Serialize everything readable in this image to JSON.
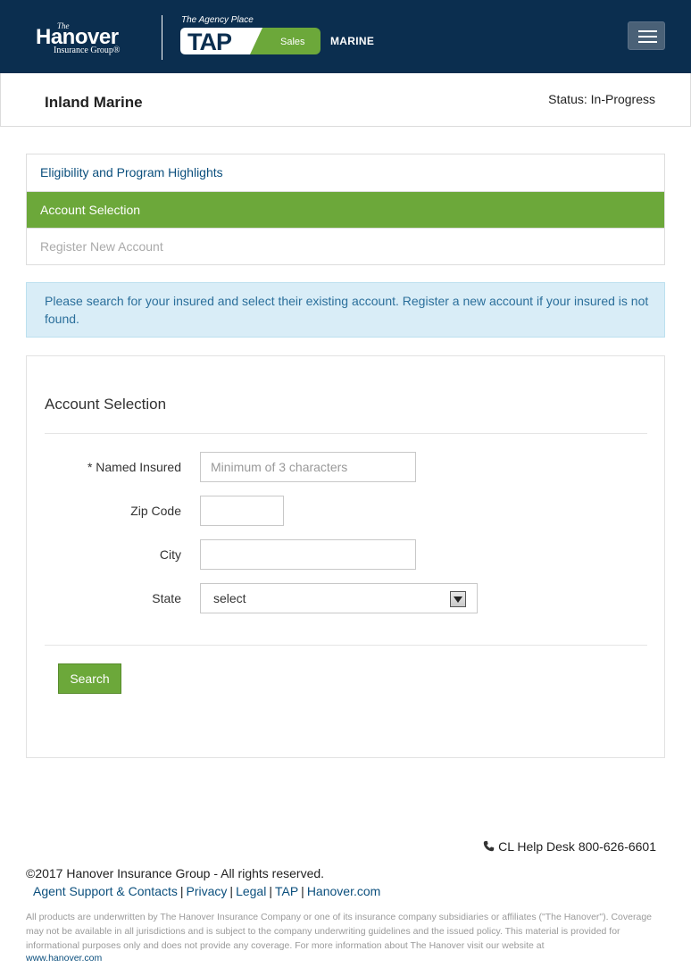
{
  "header": {
    "brand": {
      "the": "The",
      "name": "Hanover",
      "sub": "Insurance Group®"
    },
    "tap": {
      "caption": "The Agency Place",
      "badge_text": "TAP",
      "badge_sub": "Sales",
      "product": "MARINE"
    },
    "colors": {
      "navy": "#0b2e4f",
      "green": "#6ca83a"
    }
  },
  "title_bar": {
    "title": "Inland Marine",
    "status": "Status: In-Progress"
  },
  "steps": [
    {
      "label": "Eligibility and Program Highlights",
      "state": "link"
    },
    {
      "label": "Account Selection",
      "state": "active"
    },
    {
      "label": "Register New Account",
      "state": "disabled"
    }
  ],
  "info_message": "Please search for your insured and select their existing account. Register a new account if your insured is not found.",
  "form": {
    "title": "Account Selection",
    "named_insured": {
      "label": "* Named Insured",
      "placeholder": "Minimum of 3 characters",
      "value": ""
    },
    "zip": {
      "label": "Zip Code",
      "value": ""
    },
    "city": {
      "label": "City",
      "value": ""
    },
    "state": {
      "label": "State",
      "selected": "select"
    },
    "search_label": "Search"
  },
  "footer": {
    "helpdesk": "CL Help Desk 800-626-6601",
    "copyright": "©2017 Hanover Insurance Group - All rights reserved.",
    "links": [
      "Agent Support & Contacts",
      "Privacy",
      "Legal",
      "TAP",
      "Hanover.com"
    ],
    "disclaimer": "All products are underwritten by The Hanover Insurance Company or one of its insurance company subsidiaries or affiliates (\"The Hanover\"). Coverage may not be available in all jurisdictions and is subject to the company underwriting guidelines and the issued policy. This material is provided for informational purposes only and does not provide any coverage. For more information about The Hanover visit our website at",
    "website": "www.hanover.com"
  }
}
